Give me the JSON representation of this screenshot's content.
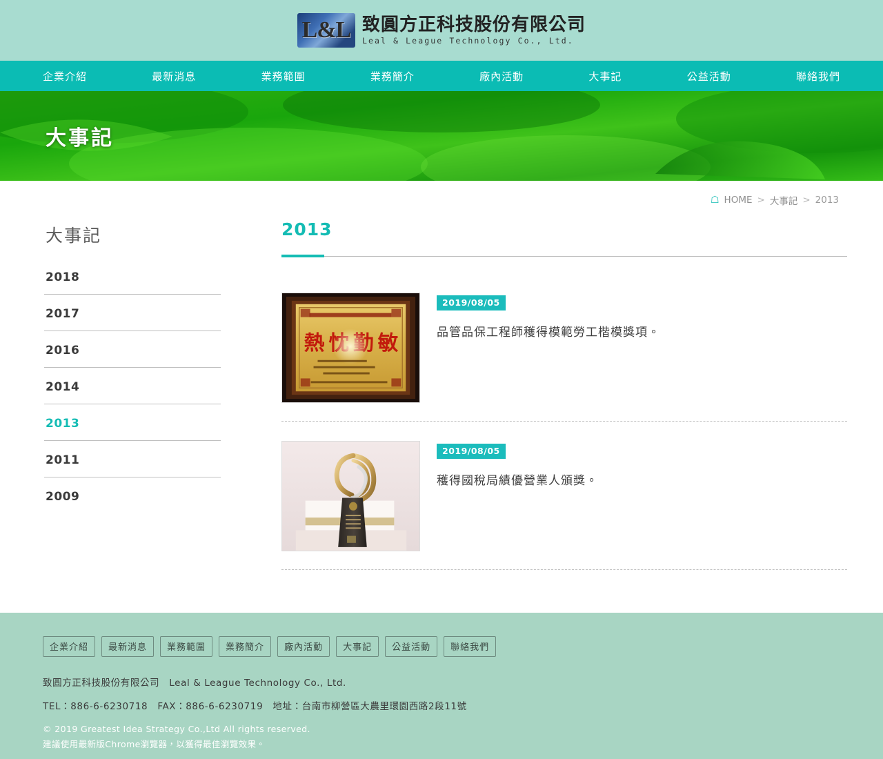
{
  "header": {
    "logo_mark_text": "L&L",
    "company_cn": "致圓方正科技股份有限公司",
    "company_en": "Leal & League Technology Co., Ltd.",
    "bg_color": "#a8dcd0"
  },
  "nav": {
    "bg_color": "#0bbcb4",
    "items": [
      {
        "label": "企業介紹"
      },
      {
        "label": "最新消息"
      },
      {
        "label": "業務範圍"
      },
      {
        "label": "業務簡介"
      },
      {
        "label": "廠內活動"
      },
      {
        "label": "大事記"
      },
      {
        "label": "公益活動"
      },
      {
        "label": "聯絡我們"
      }
    ]
  },
  "banner": {
    "title": "大事記",
    "image_description": "red-mock-strawberry-on-green-leaves"
  },
  "breadcrumb": {
    "home_icon": "home-icon",
    "home_label": "HOME",
    "separator": ">",
    "section": "大事記",
    "current": "2013"
  },
  "sidebar": {
    "title": "大事記",
    "items": [
      {
        "label": "2018",
        "active": false
      },
      {
        "label": "2017",
        "active": false
      },
      {
        "label": "2016",
        "active": false
      },
      {
        "label": "2014",
        "active": false
      },
      {
        "label": "2013",
        "active": true
      },
      {
        "label": "2011",
        "active": false
      },
      {
        "label": "2009",
        "active": false
      }
    ],
    "active_color": "#14bcb4"
  },
  "main": {
    "page_title": "2013",
    "accent_color": "#14bcb4",
    "news": [
      {
        "date": "2019/08/05",
        "text": "品管品保工程師穫得模範勞工楷模獎項。",
        "thumb_name": "award-plaque-photo",
        "thumb_description": "framed gold plaque with red characters 熱忱勤敏"
      },
      {
        "date": "2019/08/05",
        "text": "穫得國稅局績優營業人頒獎。",
        "thumb_name": "trophy-photo",
        "thumb_description": "gold swirl trophy on black base"
      }
    ]
  },
  "footer": {
    "bg_color": "#a8d5c3",
    "nav": [
      {
        "label": "企業介紹"
      },
      {
        "label": "最新消息"
      },
      {
        "label": "業務範圍"
      },
      {
        "label": "業務簡介"
      },
      {
        "label": "廠內活動"
      },
      {
        "label": "大事記"
      },
      {
        "label": "公益活動"
      },
      {
        "label": "聯絡我們"
      }
    ],
    "company_line": "致圓方正科技股份有限公司　Leal & League Technology Co., Ltd.",
    "contact_line": "TEL：886-6-6230718　FAX：886-6-6230719　地址：台南市柳營區大農里環園西路2段11號",
    "copyright": "© 2019 Greatest Idea Strategy Co.,Ltd All rights reserved.",
    "browser_note": "建議使用最新版Chrome瀏覽器，以獲得最佳瀏覽效果。"
  }
}
